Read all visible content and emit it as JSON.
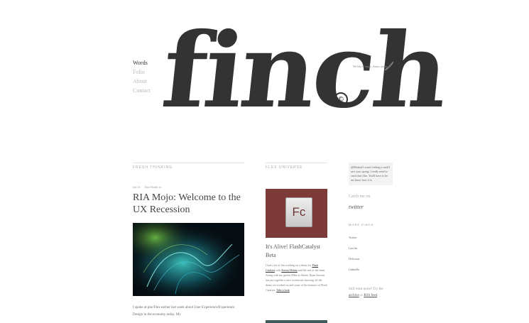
{
  "nav": {
    "items": [
      {
        "label": "Words",
        "active": true
      },
      {
        "label": "Folio",
        "active": false
      },
      {
        "label": "About",
        "active": false
      },
      {
        "label": "Contact",
        "active": false
      }
    ]
  },
  "logo": {
    "text": "finch",
    "mark": "©"
  },
  "tagline": "We like it happy. Some cream.",
  "main": {
    "section_title": "Fresh Thinking",
    "meta_date": "Jan 14",
    "meta_tag": "Dare Hardly in",
    "post_title": "RIA Mojo: Welcome to the UX Recession",
    "excerpt": "I spoke at pin//Flex earlier last week about User Experience/Experience Design in the economy today. My"
  },
  "col2": {
    "section_title": "Flex Universe",
    "card_icon_text": "Fc",
    "post_title": "It's Alive! FlashCatalyst Beta",
    "body_1": "I had a lot of fun working on a demo for",
    "body_link_1": "Flash Catalyst",
    "body_2": "with",
    "body_link_2": "Steven Heintz",
    "body_3": "and the rest of the team. Along with my guests Mike at Adobe. Ryan Stewart has put together a nice screencast showing off the demo we worked on and some of the features of Flash Catalyst.",
    "body_link_3": "Take a look"
  },
  "col3": {
    "tweet": "@Elladad I wasn't feeling it until I saw your spring. I really need to catch that film. You'll have to let me know how it is.",
    "catch_label": "Catch me on",
    "catch_handle": "twitter",
    "more_title": "More Finch",
    "more_items": [
      "Twitter",
      "Last.fm",
      "Delicious",
      "LinkedIn"
    ],
    "archive_prefix": "Still want more? Try the",
    "archive_link": "archive",
    "archive_mid": "or",
    "rss_link": "RSS feed"
  },
  "colors": {
    "fc_card_bg": "#7c3a38",
    "post_image_bg": "#050d12",
    "text_dark": "#333333"
  }
}
